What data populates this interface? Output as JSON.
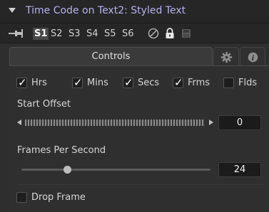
{
  "header": {
    "title": "Time Code on Text2: Styled Text"
  },
  "versions": {
    "items": [
      "S1",
      "S2",
      "S3",
      "S4",
      "S5",
      "S6"
    ],
    "active_index": 0
  },
  "tabs": {
    "controls_label": "Controls",
    "icons": [
      "gear-icon",
      "info-icon"
    ]
  },
  "checkboxes": [
    {
      "label": "Hrs",
      "checked": true
    },
    {
      "label": "Mins",
      "checked": true
    },
    {
      "label": "Secs",
      "checked": true
    },
    {
      "label": "Frms",
      "checked": true
    },
    {
      "label": "Flds",
      "checked": false
    }
  ],
  "start_offset": {
    "label": "Start Offset",
    "value": "0"
  },
  "fps": {
    "label": "Frames Per Second",
    "value": "24",
    "slider_fraction": 0.24
  },
  "drop_frame": {
    "label": "Drop Frame",
    "checked": false
  },
  "colors": {
    "title": "#b6b2f0",
    "panel_bg": "#2e2e2e",
    "field_bg": "#1b1b1b"
  }
}
